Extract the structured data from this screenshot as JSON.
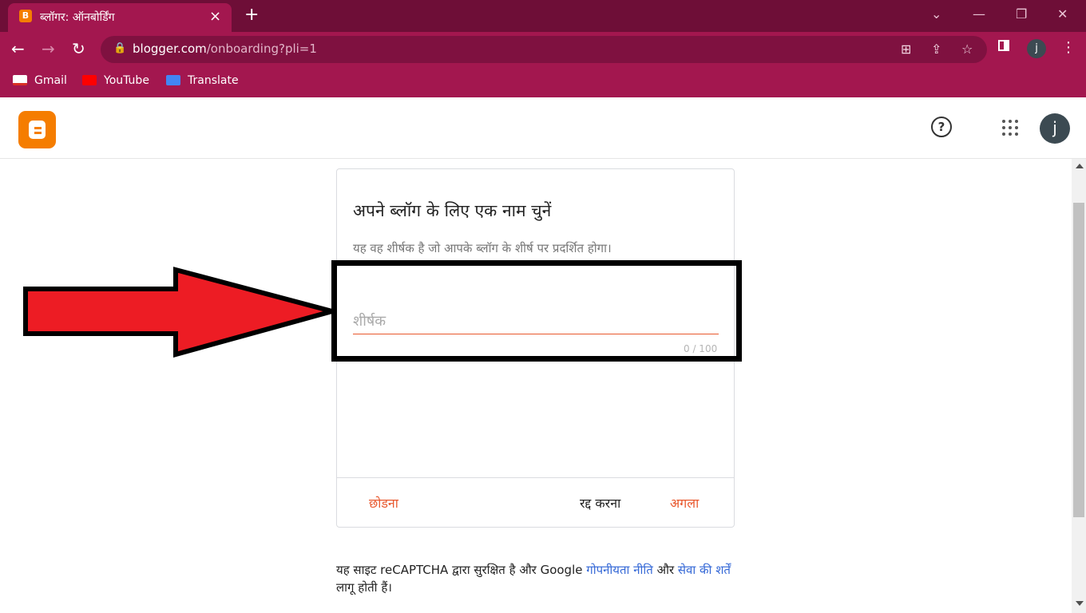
{
  "browser": {
    "tab_title": "ब्लॉगर: ऑनबोर्डिंग",
    "tab_favicon_letter": "B",
    "url_domain": "blogger.com",
    "url_path": "/onboarding?pli=1",
    "profile_initial": "j",
    "bookmarks": [
      {
        "label": "Gmail",
        "icon": "gmail-icon"
      },
      {
        "label": "YouTube",
        "icon": "youtube-icon"
      },
      {
        "label": "Translate",
        "icon": "translate-icon"
      }
    ],
    "icons": {
      "close": "×",
      "new_tab": "+",
      "back": "←",
      "forward": "→",
      "reload": "↻",
      "minimize": "—",
      "restore": "❐",
      "window_close": "✕",
      "chevron": "⌄",
      "lock": "🔒",
      "share": "⇪",
      "star": "☆",
      "menu": "⋮",
      "translate": "⊞"
    }
  },
  "header": {
    "account_initial": "j",
    "help_glyph": "?"
  },
  "dialog": {
    "title": "अपने ब्लॉग के लिए एक नाम चुनें",
    "subtitle": "यह वह शीर्षक है जो आपके ब्लॉग के शीर्ष पर प्रदर्शित होगा।",
    "input_placeholder": "शीर्षक",
    "input_value": "",
    "char_counter": "0 / 100",
    "skip_label": "छोडना",
    "cancel_label": "रद्द करना",
    "next_label": "अगला"
  },
  "footer": {
    "text_before": "यह साइट reCAPTCHA द्वारा सुरक्षित है और Google ",
    "privacy_link": "गोपनीयता नीति",
    "text_middle": " और ",
    "terms_link": "सेवा की शर्तें",
    "text_after": " लागू होती हैं।"
  },
  "colors": {
    "chrome_dark": "#6e0e37",
    "chrome_main": "#a3174f",
    "blogger_orange": "#f57d00",
    "accent": "#e8572c",
    "link": "#3367d6",
    "arrow_red": "#ed1c24"
  }
}
